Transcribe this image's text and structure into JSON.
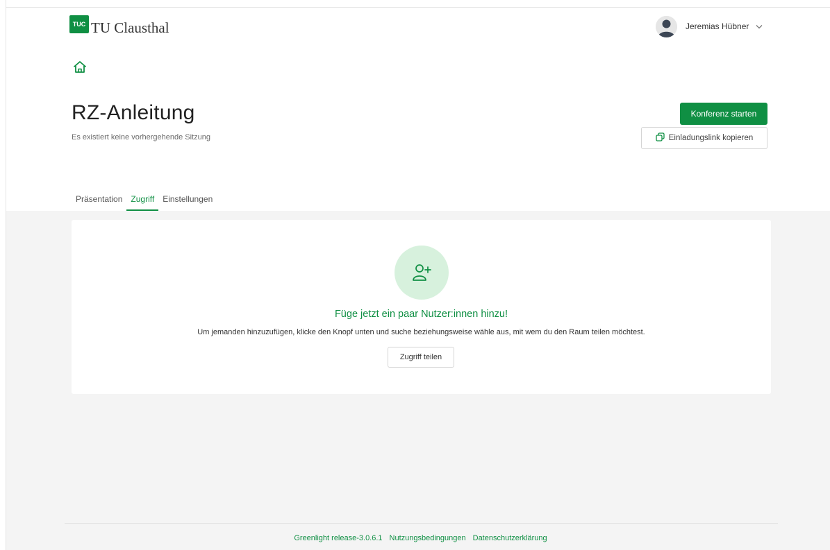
{
  "brand": {
    "logo_mark": "TUC",
    "name": "TU Clausthal",
    "accent_color": "#0f8f43"
  },
  "user": {
    "name": "Jeremias Hübner",
    "avatar_icon": "person-avatar-icon",
    "menu_icon": "chevron-down-icon"
  },
  "nav": {
    "home_icon": "home-icon"
  },
  "room": {
    "title": "RZ-Anleitung",
    "subtitle": "Es existiert keine vorhergehende Sitzung"
  },
  "actions": {
    "start_label": "Konferenz starten",
    "copy_label": "Einladungslink kopieren",
    "copy_icon": "copy-icon"
  },
  "tabs": [
    {
      "label": "Präsentation",
      "active": false
    },
    {
      "label": "Zugriff",
      "active": true
    },
    {
      "label": "Einstellungen",
      "active": false
    }
  ],
  "access": {
    "icon": "user-plus-icon",
    "heading": "Füge jetzt ein paar Nutzer:innen hinzu!",
    "description": "Um jemanden hinzuzufügen, klicke den Knopf unten und suche beziehungsweise wähle aus, mit wem du den Raum teilen möchtest.",
    "share_label": "Zugriff teilen"
  },
  "footer": {
    "release": "Greenlight release-3.0.6.1",
    "terms": "Nutzungsbedingungen",
    "privacy": "Datenschutzerklärung"
  }
}
